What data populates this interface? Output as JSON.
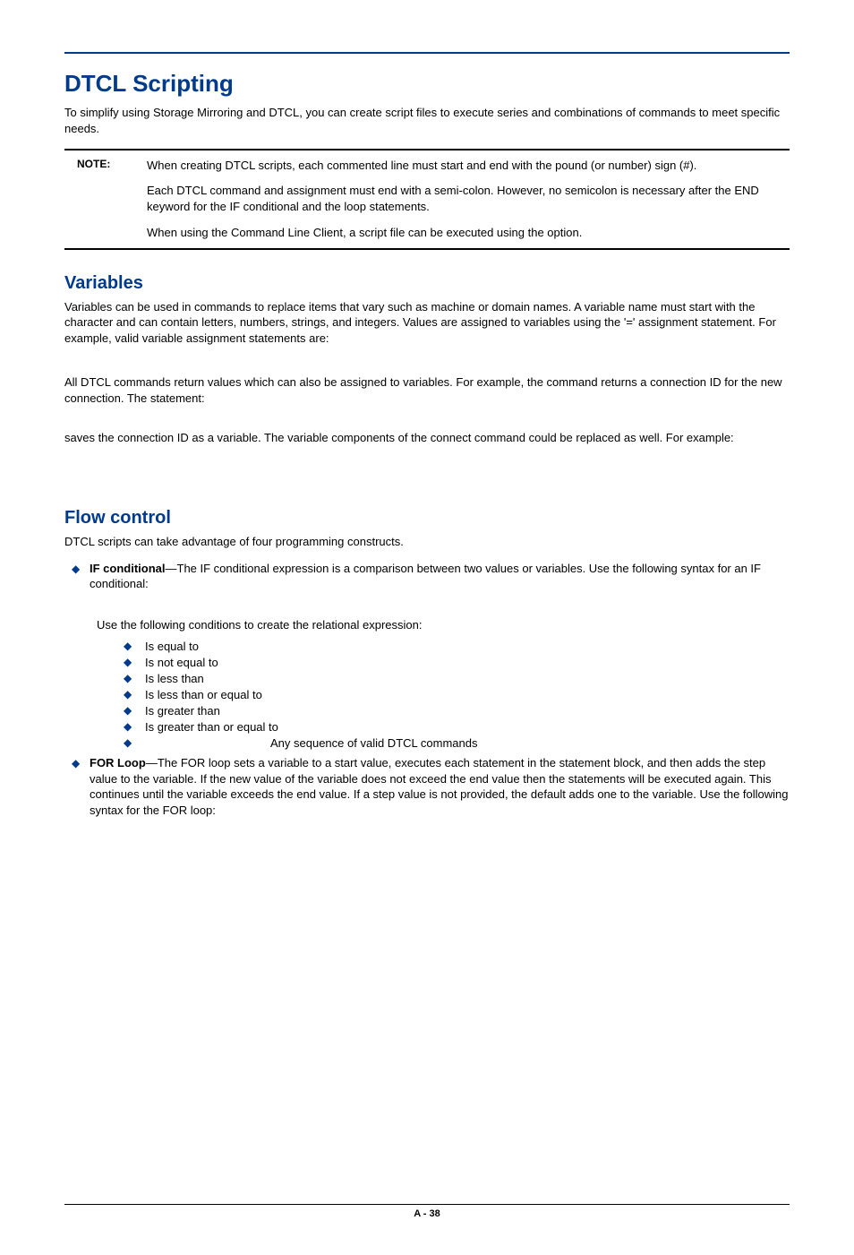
{
  "title": "DTCL Scripting",
  "intro": "To simplify using Storage Mirroring and DTCL, you can create script files to execute series and combinations of commands to meet specific needs.",
  "note": {
    "label": "NOTE:",
    "lines": [
      "When creating DTCL scripts, each commented line must start and end with the pound (or number) sign (#).",
      "Each DTCL command and assignment must end with a semi-colon.  However, no semicolon is necessary after the END keyword for the IF conditional and the loop statements.",
      "When using the Command Line Client, a script file can be executed using the      option."
    ]
  },
  "variables": {
    "heading": "Variables",
    "p1": "Variables can be used in commands to replace items that vary such as machine or domain names.  A variable name must start with the     character and can contain letters, numbers, strings, and integers.  Values are assigned to variables using the '='  assignment statement.  For example, valid variable assignment statements are:",
    "p2": "All DTCL commands return values which can also be assigned to variables.   For example, the                   command returns a connection ID for the new connection.   The statement:",
    "p3": "saves the connection ID as a variable.  The variable components of the connect command could be replaced as well.   For example:"
  },
  "flow": {
    "heading": "Flow control",
    "lead": "DTCL scripts can take advantage of four programming constructs.",
    "if_bold": "IF conditional",
    "if_rest": "—The IF conditional expression is a comparison between two values or variables.  Use the following syntax for an IF conditional:",
    "cond_lead": "Use the following conditions to create the relational expression:",
    "conds": [
      "Is equal to",
      " Is not equal to",
      "Is less than",
      " Is less than or equal to",
      "Is greater than",
      " Is greater than or equal to",
      "Any sequence of valid DTCL commands"
    ],
    "for_bold": "FOR Loop",
    "for_rest": "—The FOR loop sets a variable to a start value, executes each statement in the statement block, and then adds the step value to the variable.  If the new value of the variable does not exceed the end value then the statements will be executed again.  This continues until the variable exceeds the end value.  If a step value is not provided, the default adds one to the variable. Use the following syntax for the FOR loop:"
  },
  "pagenum": "A - 38"
}
